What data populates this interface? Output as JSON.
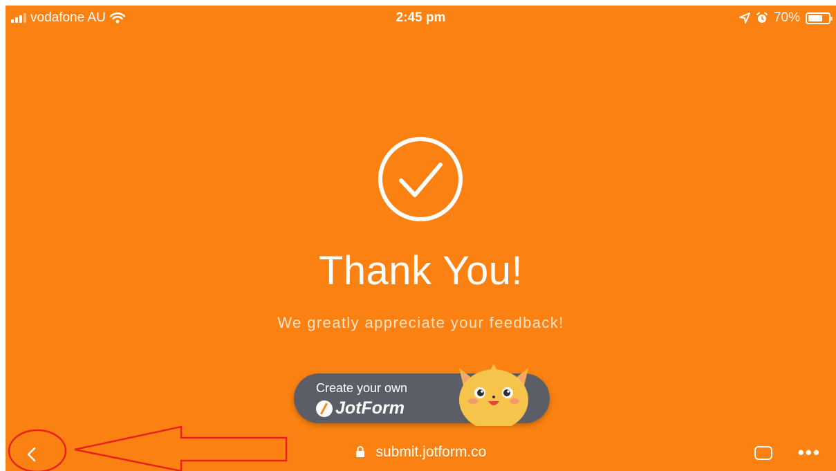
{
  "status_bar": {
    "carrier": "vodafone AU",
    "time": "2:45 pm",
    "battery_percent_label": "70%",
    "battery_level": 0.7
  },
  "main": {
    "title": "Thank You!",
    "subtitle": "We greatly appreciate your feedback!"
  },
  "badge": {
    "line1": "Create your own",
    "brand": "JotForm"
  },
  "browser_bar": {
    "url": "submit.jotform.co",
    "more_label": "•••"
  },
  "colors": {
    "background": "#fb8212",
    "badge": "#5b5e66",
    "annotation": "#e8211d"
  },
  "icons": [
    "signal-icon",
    "wifi-icon",
    "location-icon",
    "alarm-icon",
    "battery-icon",
    "check-circle-icon",
    "mascot-icon",
    "back-chevron-icon",
    "lock-icon",
    "tabs-icon",
    "more-icon"
  ]
}
